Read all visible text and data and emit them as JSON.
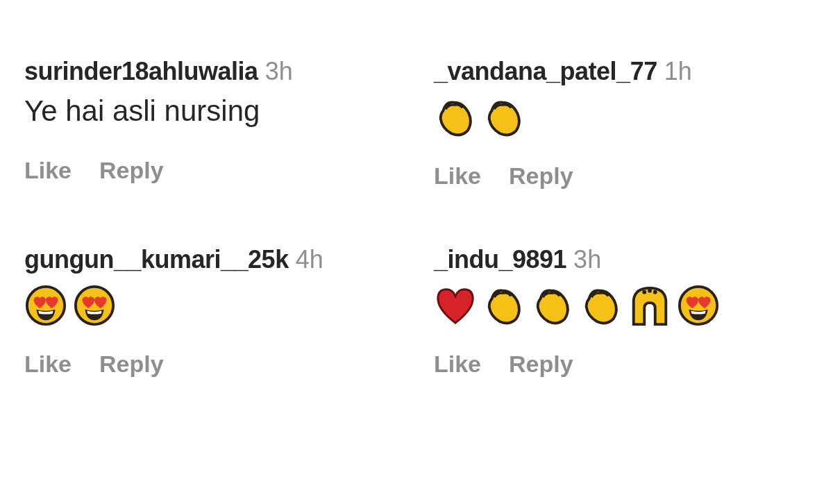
{
  "comments": [
    {
      "user": "surinder18ahluwalia",
      "time": "3h",
      "text": "Ye hai asli nursing",
      "actions": [
        "Like",
        "Reply"
      ]
    },
    {
      "user": "_vandana_patel_77",
      "time": "1h",
      "emojis": [
        {
          "kind": "clap"
        },
        {
          "kind": "clap"
        }
      ],
      "actions": [
        "Like",
        "Reply"
      ]
    },
    {
      "user": "gungun__kumari__25k",
      "time": "4h",
      "emojis": [
        {
          "kind": "heart-eyes"
        },
        {
          "kind": "heart-eyes"
        }
      ],
      "actions": [
        "Like",
        "Reply"
      ]
    },
    {
      "user": "_indu_9891",
      "time": "3h",
      "emojis": [
        {
          "kind": "heart"
        },
        {
          "kind": "clap"
        },
        {
          "kind": "clap"
        },
        {
          "kind": "clap"
        },
        {
          "kind": "raised-hands"
        },
        {
          "kind": "heart-eyes"
        }
      ],
      "actions": [
        "Like",
        "Reply"
      ]
    }
  ]
}
